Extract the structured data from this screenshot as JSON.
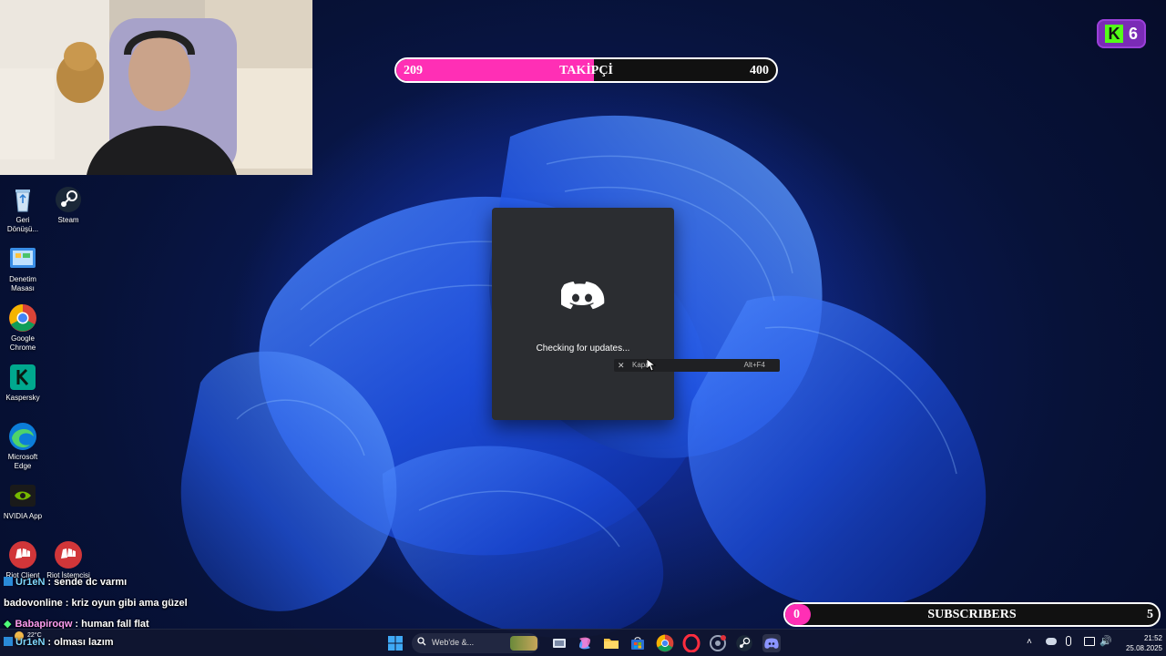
{
  "overlay": {
    "follower_goal": {
      "current": "209",
      "label": "TAKİPÇİ",
      "target": "400",
      "progress_fraction": 0.52,
      "fill_color": "#ff2fb5"
    },
    "kick_badge": {
      "logo_letter": "K",
      "count": "6",
      "bg_color": "#7a2bb6",
      "logo_color": "#53fc18"
    },
    "subscriber_goal": {
      "current": "0",
      "label": "SUBSCRIBERS",
      "target": "5"
    },
    "chat": [
      {
        "user": "Ur1eN",
        "message": ": sende dc varmı",
        "user_color": "#7fd8ff",
        "badge_icon": ""
      },
      {
        "user": "badovonline",
        "message": ": kriz oyun gibi ama güzel",
        "user_color": "#ffffff",
        "badge_icon": ""
      },
      {
        "user": "Babapiroqw",
        "message": ": human fall flat",
        "user_color": "#ff9df0",
        "badge_icon": "diamond-icon"
      },
      {
        "user": "Ur1eN",
        "message": ": olması lazım",
        "user_color": "#7fd8ff",
        "badge_icon": ""
      }
    ]
  },
  "desktop": {
    "icons": [
      {
        "label": "Geri Dönüşü...",
        "icon": "recycle-bin-icon"
      },
      {
        "label": "Steam",
        "icon": "steam-icon"
      },
      {
        "label": "Denetim Masası",
        "icon": "control-panel-icon"
      },
      {
        "label": "Google Chrome",
        "icon": "chrome-icon"
      },
      {
        "label": "Kaspersky",
        "icon": "kaspersky-icon"
      },
      {
        "label": "Microsoft Edge",
        "icon": "edge-icon"
      },
      {
        "label": "NVIDIA App",
        "icon": "nvidia-icon"
      },
      {
        "label": "Riot Client",
        "icon": "riot-icon"
      },
      {
        "label": "Riot İstemcisi",
        "icon": "riot-icon"
      }
    ]
  },
  "discord": {
    "status": "Checking for updates...",
    "context_menu": {
      "item": "Kapat",
      "shortcut": "Alt+F4"
    }
  },
  "taskbar": {
    "search_placeholder": "Web'de &...",
    "weather": {
      "temp": "22°C"
    },
    "clock": {
      "time": "21:52",
      "date": "25.08.2025"
    }
  }
}
